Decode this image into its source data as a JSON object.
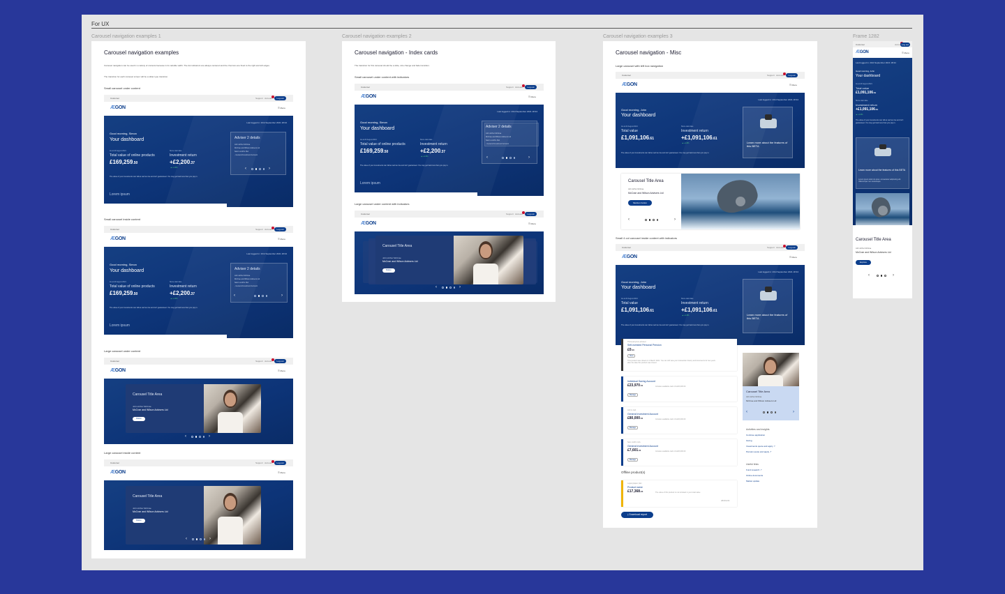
{
  "canvas": {
    "title": "For UX"
  },
  "labels": {
    "f1": "Carousel navigation examples 1",
    "f2": "Carousel navigation examples 2",
    "f3": "Carousel navigation examples 3",
    "f4": "Frame 1282"
  },
  "f1": {
    "title": "Carousel navigation examples",
    "note1": "Carousel navigation can be used in a variety of contexts because in its variable width. The dot indicators are always centered and the chevrons are fixed to the right and left edges.",
    "note2": "The transition for each carousel screen will be a slider type transition.",
    "s1": "Small carousel under content",
    "s2": "Small carousel inside content",
    "s3": "Large carousel under content",
    "s4": "Large carousel inside content"
  },
  "f2": {
    "title": "Carousel navigation - Index cards",
    "note": "The transition for this carousel should be a slide, size change and fade transition.",
    "s1": "Small carousel under content with indicators",
    "s2": "Large carousel under content with indicators"
  },
  "f3": {
    "title": "Carousel navigation - Misc",
    "s1": "Large carousel with left box navigation",
    "s2": "Small 4 col carousel inside content with indicators"
  },
  "mock": {
    "customer": "Customer",
    "support": "Support",
    "account": "Account",
    "login": "Log out",
    "logo_a": "Æ",
    "logo_b": "GON",
    "menu": "☰  Menu",
    "last_logged": "Last logged in: 23rd September 2021 18:34",
    "greeting_simon": "Good morning, Simon",
    "greeting_john": "Good morning, John",
    "dashboard": "Your dashboard",
    "as_at": "As at 24 August 2021",
    "since": "Since start date",
    "total_online": "Total value of online products",
    "total_value": "Total value",
    "invest_return": "Investment return",
    "val_simon": "£169,259",
    "val_simon_p": ".50",
    "ret_simon": "+£2,200",
    "ret_simon_p": ".37",
    "val_john": "£1,091,106",
    "val_john_p": ".61",
    "ret_john": "+£1,091,106",
    "ret_john_p": ".61",
    "green": "▲ +1.3%",
    "disclaimer": "The value of your investments can fall as well as rise and isn't guaranteed. You may get back less than you pay in.",
    "lorem": "Lorem ipsum",
    "adviser_title": "Adviser 2 details",
    "adviser_lines": [
      "John Arthur McCrae",
      "McCrae and Wilson Advisers Ltd",
      "Sam's smith's ISA",
      "- General Investment Account"
    ],
    "card_title": "Carousel Title Area",
    "card_name": "John Arthur McCrae",
    "card_firm": "McCrae and Wilson Advisers Ltd",
    "card_button": "Button",
    "medium_button": "Medium button",
    "learn": "Learn more about the features of this BETA",
    "learn_sub": "Lorem ipsum dolor sit amet, consectetur adipiscing elit. Ullamcorper nec scelerisque.",
    "explore": "Explore"
  },
  "products": [
    {
      "sub": "Third-party/non-advised",
      "title": "Self-invested Personal Pension",
      "value": "£0",
      "pence": ".00",
      "note": "This product was closed on 4 March 2021. You can still view your transaction history and documents for two years after the date this product was closed.",
      "btn": "View",
      "accent": "#333333"
    },
    {
      "sub": "",
      "title": "Individual Saving Account",
      "value": "£23,970",
      "pence": ".31",
      "note": "Includes available cash of £120,000.00",
      "btn": "Manage",
      "accent": "#0c3e8c"
    },
    {
      "sub": "John's GIA",
      "title": "General Investment Account",
      "value": "£80,000",
      "pence": ".31",
      "note": "Includes available cash of £120,000.00",
      "btn": "Manage",
      "accent": "#0c3e8c"
    },
    {
      "sub": "Sam smith's GIA",
      "title": "General Investment Account",
      "value": "£7,601",
      "pence": ".31",
      "note": "Includes available cash of £120,000.00",
      "btn": "Manage",
      "accent": "#0c3e8c"
    }
  ],
  "offline": {
    "heading": "Offline product(s)",
    "sub": "Legacy/paper plan",
    "title": "Product name",
    "value": "£17,368",
    "pence": ".23",
    "note": "The value of this product is not included in your total value",
    "ref": "AB/001234",
    "download": "⤓  Download report"
  },
  "sidebar": {
    "activities_title": "Activities and insights",
    "activities": [
      "Continue application",
      "Giving",
      "Investments quote and apply ↗",
      "Pension quote and apply ↗"
    ],
    "useful_title": "Useful links",
    "useful": [
      "Fund research ↗",
      "Online documents",
      "Market update"
    ]
  },
  "mobile": {
    "as_at": "As at 24 August 2021",
    "since": "Since start date"
  }
}
